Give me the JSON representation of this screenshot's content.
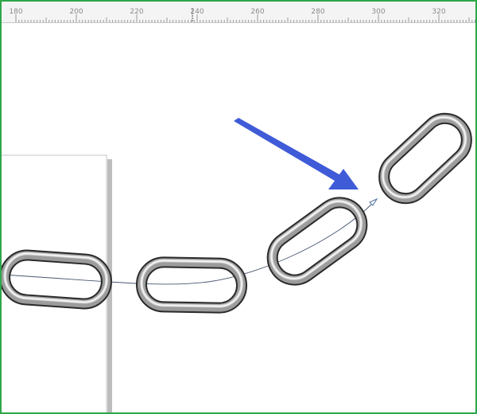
{
  "ruler": {
    "labels": [
      "180",
      "200",
      "220",
      "240",
      "260",
      "280",
      "300",
      "320"
    ]
  },
  "canvas": {
    "background": "#ffffff",
    "page_edge_color": "#bdbdbd",
    "guide_color": "#7f8fa3",
    "arrow_color": "#3e5ad6",
    "chain_link_colors": [
      "#2a2a2a",
      "#f2f2f2",
      "#9a9a9a"
    ],
    "chain_link_count": 4
  }
}
